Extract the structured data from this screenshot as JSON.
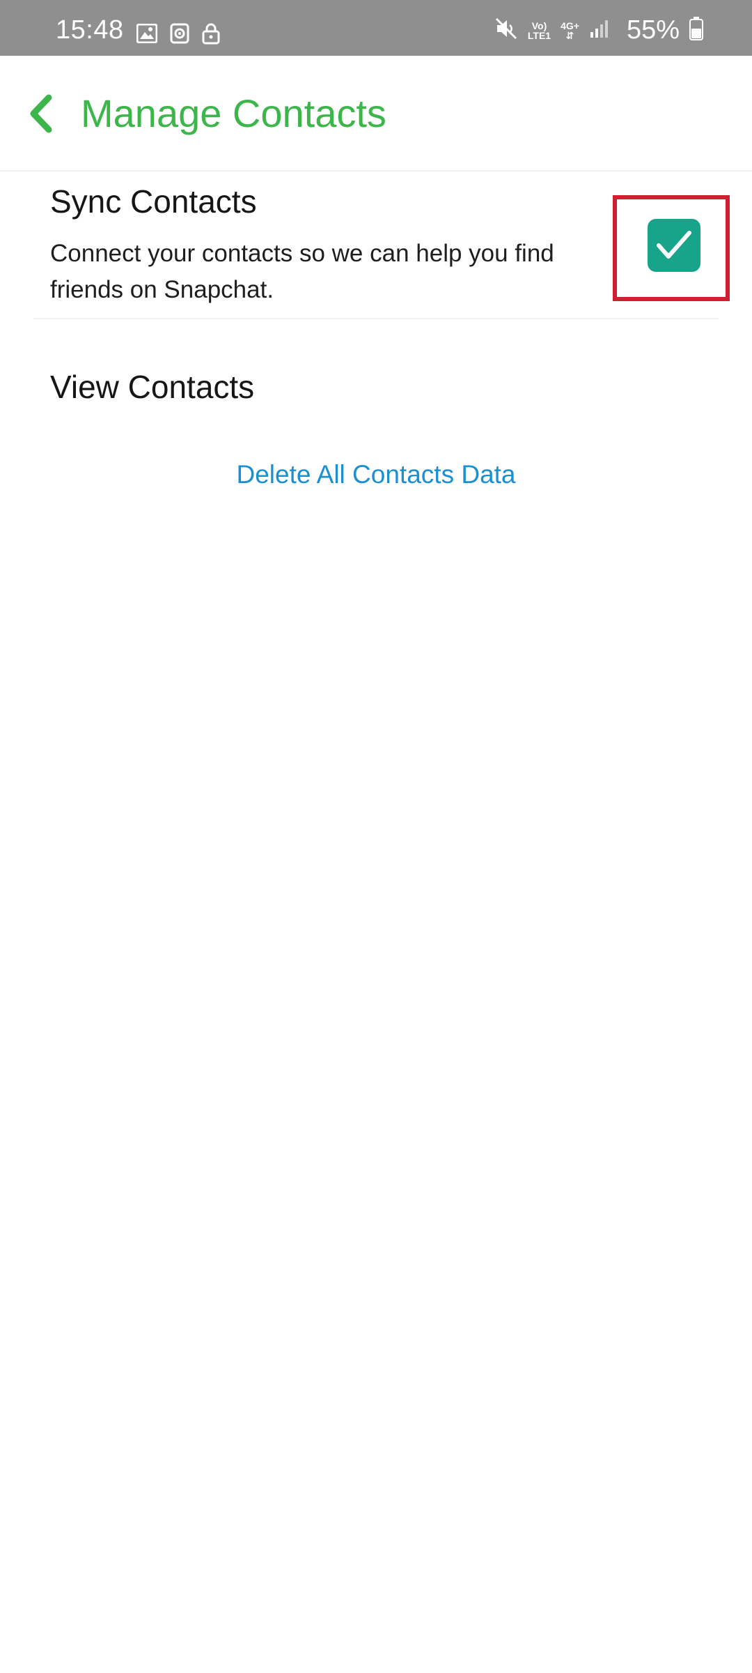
{
  "status_bar": {
    "time": "15:48",
    "network_top": "Vo)",
    "network_bottom": "LTE1",
    "data_type": "4G+",
    "battery": "55%"
  },
  "header": {
    "title": "Manage Contacts"
  },
  "sync": {
    "title": "Sync Contacts",
    "description": "Connect your contacts so we can help you find friends on Snapchat.",
    "checked": true
  },
  "view_contacts": {
    "label": "View Contacts"
  },
  "delete": {
    "label": "Delete All Contacts Data"
  },
  "colors": {
    "accent": "#3cb54a",
    "checkbox": "#17a48a",
    "link": "#1a8fd1",
    "highlight": "#d0202f"
  }
}
